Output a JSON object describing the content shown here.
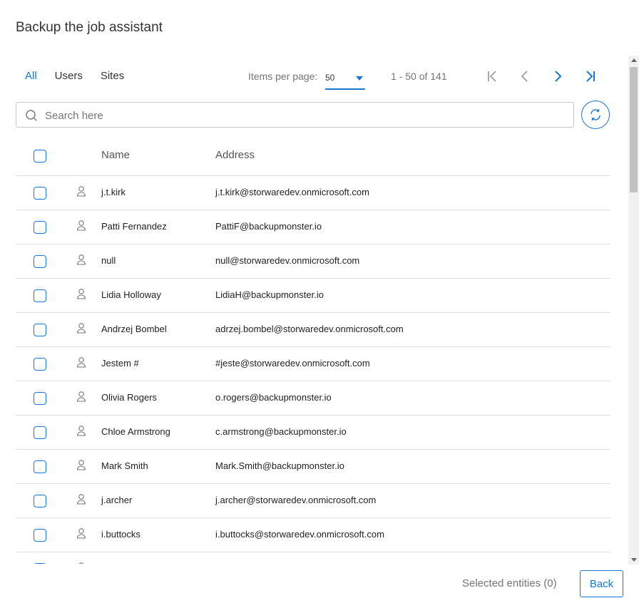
{
  "dialog": {
    "title": "Backup the job assistant"
  },
  "tabs": [
    {
      "label": "All",
      "active": true
    },
    {
      "label": "Users",
      "active": false
    },
    {
      "label": "Sites",
      "active": false
    }
  ],
  "pagination": {
    "items_per_page_label": "Items per page:",
    "items_per_page_value": "50",
    "range_text": "1 - 50 of 141",
    "buttons": [
      "first-page-icon",
      "previous-page-icon",
      "next-page-icon",
      "last-page-icon"
    ]
  },
  "search": {
    "placeholder": "Search here",
    "value": ""
  },
  "table": {
    "headers": {
      "name": "Name",
      "address": "Address"
    },
    "rows": [
      {
        "name": "j.t.kirk",
        "address": "j.t.kirk@storwaredev.onmicrosoft.com"
      },
      {
        "name": "Patti Fernandez",
        "address": "PattiF@backupmonster.io"
      },
      {
        "name": "null",
        "address": "null@storwaredev.onmicrosoft.com"
      },
      {
        "name": "Lidia Holloway",
        "address": "LidiaH@backupmonster.io"
      },
      {
        "name": "Andrzej Bombel",
        "address": "adrzej.bombel@storwaredev.onmicrosoft.com"
      },
      {
        "name": "Jestem #",
        "address": "#jeste@storwaredev.onmicrosoft.com"
      },
      {
        "name": "Olivia Rogers",
        "address": "o.rogers@backupmonster.io"
      },
      {
        "name": "Chloe Armstrong",
        "address": "c.armstrong@backupmonster.io"
      },
      {
        "name": "Mark Smith",
        "address": "Mark.Smith@backupmonster.io"
      },
      {
        "name": "j.archer",
        "address": "j.archer@storwaredev.onmicrosoft.com"
      },
      {
        "name": "i.buttocks",
        "address": "i.buttocks@storwaredev.onmicrosoft.com"
      },
      {
        "name": "",
        "address": ""
      }
    ]
  },
  "footer": {
    "selected_text": "Selected entities (0)",
    "back_label": "Back"
  },
  "colors": {
    "accent": "#1976d2",
    "muted": "#757575",
    "border": "#dcdcdc"
  }
}
